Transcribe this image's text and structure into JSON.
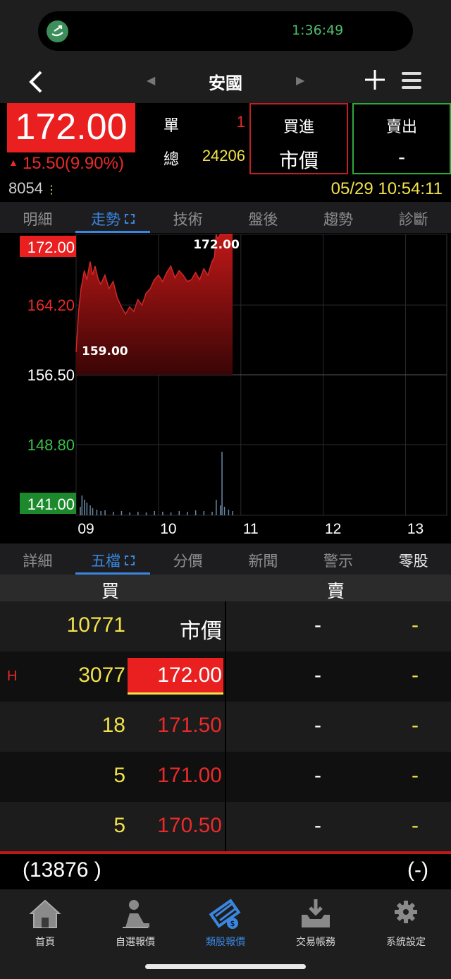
{
  "status": {
    "time": "1:36:49"
  },
  "nav": {
    "title": "安國",
    "prev_arrow": "◀",
    "next_arrow": "▶"
  },
  "quote": {
    "price": "172.00",
    "change_arrow": "▲",
    "change": "15.50(9.90%)",
    "single_label": "單",
    "single_value": "1",
    "total_label": "總",
    "total_value": "24206",
    "buy_label": "買進",
    "buy_sub": "市價",
    "sell_label": "賣出",
    "sell_sub": "-",
    "code": "8054",
    "code_dots": "⋮",
    "datetime": "05/29 10:54:11"
  },
  "top_tabs": [
    "明細",
    "走勢",
    "技術",
    "盤後",
    "趨勢",
    "診斷"
  ],
  "chart_data": {
    "type": "area",
    "y_ticks": [
      172.0,
      164.2,
      156.5,
      148.8,
      141.0
    ],
    "y_tick_labels": [
      "172.00",
      "164.20",
      "156.50",
      "148.80",
      "141.00"
    ],
    "x_tick_labels": [
      "09",
      "10",
      "11",
      "12",
      "13"
    ],
    "ylim": [
      141.0,
      172.0
    ],
    "xlim": [
      9.0,
      13.5
    ],
    "reference_price": 156.5,
    "high_label": "172.00",
    "low_label": "159.00",
    "price_series": {
      "x": [
        9.0,
        9.03,
        9.06,
        9.1,
        9.13,
        9.17,
        9.2,
        9.23,
        9.27,
        9.3,
        9.35,
        9.4,
        9.45,
        9.5,
        9.55,
        9.6,
        9.65,
        9.7,
        9.75,
        9.8,
        9.85,
        9.9,
        9.95,
        10.0,
        10.05,
        10.1,
        10.15,
        10.2,
        10.25,
        10.3,
        10.35,
        10.4,
        10.45,
        10.5,
        10.55,
        10.6,
        10.65,
        10.68,
        10.7,
        10.72,
        10.75,
        10.8,
        10.85,
        10.9
      ],
      "y": [
        159.0,
        163.5,
        166.0,
        168.0,
        167.0,
        169.0,
        167.5,
        168.5,
        167.0,
        166.5,
        167.5,
        166.0,
        166.8,
        165.0,
        164.0,
        163.2,
        164.0,
        163.5,
        164.8,
        164.2,
        165.5,
        166.0,
        167.0,
        167.5,
        166.8,
        167.8,
        168.5,
        167.2,
        168.0,
        167.5,
        166.8,
        167.0,
        167.8,
        167.0,
        168.2,
        167.5,
        169.0,
        169.5,
        172.0,
        171.5,
        172.0,
        172.0,
        172.0,
        172.0
      ]
    },
    "volume_series": {
      "x": [
        9.0,
        9.02,
        9.05,
        9.08,
        9.12,
        9.15,
        9.2,
        9.25,
        9.3,
        9.4,
        9.5,
        9.6,
        9.7,
        9.8,
        9.9,
        10.0,
        10.1,
        10.2,
        10.3,
        10.4,
        10.5,
        10.6,
        10.65,
        10.7,
        10.72,
        10.75,
        10.8,
        10.85
      ],
      "y": [
        12,
        28,
        22,
        18,
        14,
        10,
        8,
        6,
        7,
        5,
        6,
        4,
        5,
        4,
        6,
        5,
        4,
        6,
        5,
        7,
        6,
        5,
        22,
        14,
        90,
        12,
        8,
        6
      ]
    }
  },
  "bottom_tabs": [
    "詳細",
    "五檔",
    "分價",
    "新聞",
    "警示",
    "零股"
  ],
  "book": {
    "buy_header": "買",
    "sell_header": "賣",
    "rows": [
      {
        "flag": "",
        "qty": "10771",
        "price": "市價",
        "sell_price": "-",
        "sell_qty": "-"
      },
      {
        "flag": "H",
        "qty": "3077",
        "price": "172.00",
        "sell_price": "-",
        "sell_qty": "-"
      },
      {
        "flag": "",
        "qty": "18",
        "price": "171.50",
        "sell_price": "-",
        "sell_qty": "-"
      },
      {
        "flag": "",
        "qty": "5",
        "price": "171.00",
        "sell_price": "-",
        "sell_qty": "-"
      },
      {
        "flag": "",
        "qty": "5",
        "price": "170.50",
        "sell_price": "-",
        "sell_qty": "-"
      }
    ],
    "buy_total": "(13876 )",
    "sell_total": "(-)"
  },
  "bottom_nav": [
    {
      "label": "首頁",
      "icon": "home-icon"
    },
    {
      "label": "自選報價",
      "icon": "watchlist-icon"
    },
    {
      "label": "類股報價",
      "icon": "sector-quote-icon"
    },
    {
      "label": "交易帳務",
      "icon": "trade-account-icon"
    },
    {
      "label": "系統設定",
      "icon": "settings-icon"
    }
  ],
  "colors": {
    "up": "#ea2020",
    "down": "#3ac24a",
    "accent": "#3a86e0",
    "highlight": "#f2e24a"
  }
}
